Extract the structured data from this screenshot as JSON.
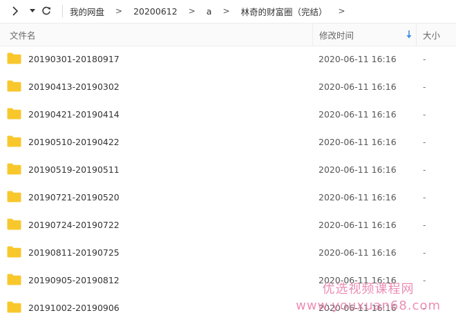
{
  "breadcrumb": {
    "items": [
      "我的网盘",
      "20200612",
      "a",
      "林奇的财富圈（完结）"
    ]
  },
  "columns": {
    "name": "文件名",
    "modified": "修改时间",
    "size": "大小"
  },
  "files": [
    {
      "name": "20190301-20180917",
      "modified": "2020-06-11 16:16",
      "size": "-"
    },
    {
      "name": "20190413-20190302",
      "modified": "2020-06-11 16:16",
      "size": "-"
    },
    {
      "name": "20190421-20190414",
      "modified": "2020-06-11 16:16",
      "size": "-"
    },
    {
      "name": "20190510-20190422",
      "modified": "2020-06-11 16:16",
      "size": "-"
    },
    {
      "name": "20190519-20190511",
      "modified": "2020-06-11 16:16",
      "size": "-"
    },
    {
      "name": "20190721-20190520",
      "modified": "2020-06-11 16:16",
      "size": "-"
    },
    {
      "name": "20190724-20190722",
      "modified": "2020-06-11 16:16",
      "size": "-"
    },
    {
      "name": "20190811-20190725",
      "modified": "2020-06-11 16:16",
      "size": "-"
    },
    {
      "name": "20190905-20190812",
      "modified": "2020-06-11 16:16",
      "size": "-"
    },
    {
      "name": "20191002-20190906",
      "modified": "2020-06-11 16:16",
      "size": "-"
    }
  ],
  "watermark": {
    "line1": "优选视频课程网",
    "line2": "www.youxuan68.com"
  },
  "colors": {
    "folder": "#f8c72c",
    "sort_arrow": "#3a8ee6",
    "watermark": "#e87aa8"
  },
  "icons": {
    "forward": "chevron-right-icon",
    "dropdown": "caret-down-icon",
    "refresh": "refresh-icon",
    "sort": "sort-descending-icon",
    "folder": "folder-icon"
  }
}
